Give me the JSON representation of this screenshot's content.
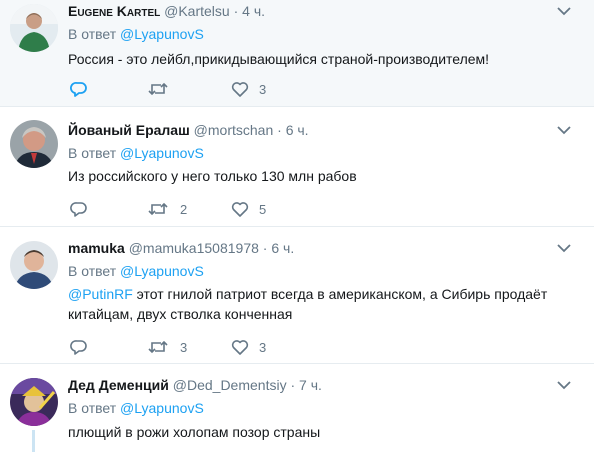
{
  "tweets": [
    {
      "name": "Eugene Kartel",
      "handle": "@Kartelsu",
      "time": "4 ч.",
      "reply_prefix": "В ответ",
      "reply_handle": "@LyapunovS",
      "text": "Россия - это лейбл,прикидывающийся страной-производителем!",
      "retweets": "",
      "likes": "3",
      "reply_icon": "reply-icon",
      "retweet_icon": "retweet-icon",
      "like_icon": "heart-icon"
    },
    {
      "name": "Йoваный Ералаш",
      "handle": "@mortschan",
      "time": "6 ч.",
      "reply_prefix": "В ответ",
      "reply_handle": "@LyapunovS",
      "text": "Из российского у него только 130 млн рабов",
      "retweets": "2",
      "likes": "5"
    },
    {
      "name": "mamuka",
      "handle": "@mamuka15081978",
      "time": "6 ч.",
      "reply_prefix": "В ответ",
      "reply_handle": "@LyapunovS",
      "text_mention": "@PutinRF",
      "text_line1": " этот гнилой патриот всегда в американском, а Сибирь продаёт",
      "text_line2": "китайцам, двух стволка конченная",
      "retweets": "3",
      "likes": "3"
    },
    {
      "name": "Дед Деменций",
      "handle": "@Ded_Dementsiy",
      "time": "7 ч.",
      "reply_prefix": "В ответ",
      "reply_handle": "@LyapunovS",
      "text": "плющий в рожи холопам позор страны"
    }
  ],
  "colors": {
    "accent": "#1da1f2",
    "secondary_text": "#657786",
    "highlight_bg": "#f5f8fa",
    "thread_line": "#cce4f3"
  }
}
